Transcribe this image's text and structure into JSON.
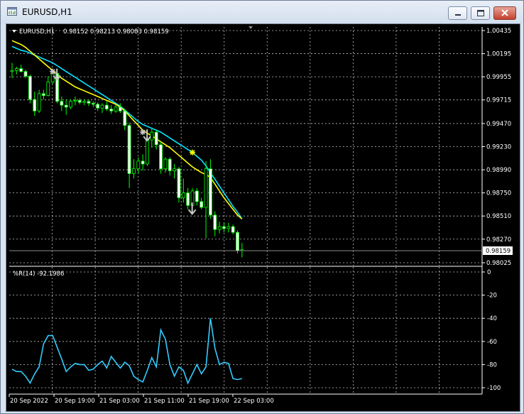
{
  "window": {
    "title": "EURUSD,H1",
    "buttons": [
      "minimize",
      "maximize",
      "close"
    ]
  },
  "chart_header": {
    "symbol_label": "EURUSD,H1",
    "ohlc_text": "0.98152 0.98213 0.98083 0.98159"
  },
  "indicator_header": {
    "label": "%R(14) -92.1986"
  },
  "price_axis_labels": [
    "1.00435",
    "1.00195",
    "0.99955",
    "0.99715",
    "0.99470",
    "0.99230",
    "0.98990",
    "0.98750",
    "0.98510",
    "0.98270",
    "0.98025"
  ],
  "current_price_label": "0.98159",
  "indicator_axis_labels": [
    "0",
    "-20",
    "-40",
    "-60",
    "-80",
    "-100"
  ],
  "time_axis_labels": [
    "20 Sep 2022",
    "20 Sep 19:00",
    "21 Sep 03:00",
    "21 Sep 11:00",
    "21 Sep 19:00",
    "22 Sep 03:00"
  ],
  "colors": {
    "background": "#000000",
    "grid": "#ffffff",
    "candle": "#00ff00",
    "candle_bull_body": "#000000",
    "candle_bear_body": "#ffffff",
    "ma_slow": "#ffff00",
    "ma_fast": "#00e5ff",
    "wpr_line": "#33ccff",
    "arrow": "#c8c8c8",
    "axis_text": "#ffffff"
  },
  "chart_data": [
    {
      "type": "candlestick",
      "title": "EURUSD,H1",
      "ylim": [
        0.98025,
        1.00435
      ],
      "ohlc": [
        [
          1.0001,
          1.001,
          0.9994,
          1.0002
        ],
        [
          1.0002,
          1.0006,
          0.9998,
          1.0004
        ],
        [
          1.0004,
          1.0008,
          1.0,
          1.0001
        ],
        [
          1.0001,
          1.0003,
          0.9994,
          0.9996
        ],
        [
          0.9996,
          0.9998,
          0.9968,
          0.9972
        ],
        [
          0.9972,
          0.998,
          0.9955,
          0.996
        ],
        [
          0.996,
          0.9982,
          0.9958,
          0.9978
        ],
        [
          0.9978,
          0.9982,
          0.9972,
          0.9976
        ],
        [
          0.9976,
          0.9996,
          0.9975,
          0.999
        ],
        [
          0.999,
          1.0001,
          0.9988,
          0.9999
        ],
        [
          0.9999,
          1.0001,
          0.9968,
          0.997
        ],
        [
          0.997,
          0.9975,
          0.996,
          0.9966
        ],
        [
          0.9966,
          0.9972,
          0.9956,
          0.9964
        ],
        [
          0.9964,
          0.9972,
          0.9962,
          0.997
        ],
        [
          0.997,
          0.9975,
          0.9966,
          0.9971
        ],
        [
          0.9971,
          0.9973,
          0.9967,
          0.9969
        ],
        [
          0.9969,
          0.9972,
          0.9966,
          0.997
        ],
        [
          0.997,
          0.9972,
          0.9965,
          0.9968
        ],
        [
          0.9968,
          0.997,
          0.9964,
          0.9967
        ],
        [
          0.9967,
          0.9969,
          0.996,
          0.9963
        ],
        [
          0.9963,
          0.9968,
          0.9958,
          0.9966
        ],
        [
          0.9966,
          0.997,
          0.996,
          0.9962
        ],
        [
          0.9962,
          0.9966,
          0.9957,
          0.996
        ],
        [
          0.996,
          0.9967,
          0.9958,
          0.9964
        ],
        [
          0.9964,
          0.9968,
          0.9958,
          0.996
        ],
        [
          0.996,
          0.9962,
          0.994,
          0.9945
        ],
        [
          0.9945,
          0.9948,
          0.988,
          0.9895
        ],
        [
          0.9895,
          0.991,
          0.989,
          0.99
        ],
        [
          0.99,
          0.9912,
          0.9895,
          0.9908
        ],
        [
          0.9908,
          0.9915,
          0.9898,
          0.9905
        ],
        [
          0.9905,
          0.9935,
          0.9903,
          0.993
        ],
        [
          0.993,
          0.9942,
          0.9922,
          0.9938
        ],
        [
          0.9938,
          0.994,
          0.992,
          0.9925
        ],
        [
          0.9925,
          0.9928,
          0.9895,
          0.99
        ],
        [
          0.99,
          0.9912,
          0.9896,
          0.991
        ],
        [
          0.991,
          0.9912,
          0.9893,
          0.9898
        ],
        [
          0.9898,
          0.9905,
          0.989,
          0.99
        ],
        [
          0.99,
          0.9902,
          0.9865,
          0.987
        ],
        [
          0.987,
          0.989,
          0.9865,
          0.9875
        ],
        [
          0.9875,
          0.988,
          0.9858,
          0.9862
        ],
        [
          0.9862,
          0.988,
          0.9858,
          0.9877
        ],
        [
          0.9877,
          0.988,
          0.9862,
          0.9866
        ],
        [
          0.9866,
          0.987,
          0.9858,
          0.986
        ],
        [
          0.986,
          0.9908,
          0.9828,
          0.99
        ],
        [
          0.99,
          0.991,
          0.9848,
          0.9852
        ],
        [
          0.9852,
          0.9856,
          0.983,
          0.9837
        ],
        [
          0.9837,
          0.9845,
          0.9833,
          0.984
        ],
        [
          0.984,
          0.9844,
          0.9834,
          0.9838
        ],
        [
          0.9838,
          0.9844,
          0.9834,
          0.984
        ],
        [
          0.984,
          0.9842,
          0.9832,
          0.9834
        ],
        [
          0.9834,
          0.9836,
          0.9812,
          0.9815
        ],
        [
          0.9815,
          0.9823,
          0.9808,
          0.9816
        ]
      ],
      "series": [
        {
          "values": [
            1.0027,
            1.0025,
            1.0023,
            1.0022,
            1.002,
            1.0018,
            1.0016,
            1.0014,
            1.0012,
            1.001,
            1.0007,
            1.0004,
            1.0001,
            0.9998,
            0.9995,
            0.9992,
            0.9989,
            0.9986,
            0.9983,
            0.998,
            0.9977,
            0.9974,
            0.9971,
            0.9968,
            0.9965,
            0.9961,
            0.9957,
            0.9953,
            0.9949,
            0.9946,
            0.9944,
            0.9942,
            0.994,
            0.9938,
            0.9935,
            0.9932,
            0.9929,
            0.9926,
            0.9923,
            0.992,
            0.9917,
            0.9913,
            0.9909,
            0.9903,
            0.9896,
            0.9889,
            0.9882,
            0.9875,
            0.9868,
            0.9861,
            0.9855,
            0.9848
          ]
        },
        {
          "values": [
            1.0033,
            1.0031,
            1.0029,
            1.0026,
            1.0022,
            1.0018,
            1.0014,
            1.001,
            1.0006,
            1.0002,
            0.9998,
            0.9994,
            0.9991,
            0.9988,
            0.9985,
            0.9983,
            0.9981,
            0.9979,
            0.9977,
            0.9975,
            0.9973,
            0.9971,
            0.9969,
            0.9967,
            0.9964,
            0.996,
            0.9955,
            0.995,
            0.9945,
            0.994,
            0.9937,
            0.9934,
            0.9931,
            0.9928,
            0.9925,
            0.9922,
            0.9918,
            0.9914,
            0.991,
            0.9906,
            0.9902,
            0.9899,
            0.9896,
            0.9894,
            0.9891,
            0.9884,
            0.9877,
            0.987,
            0.9864,
            0.9858,
            0.9852,
            0.9848
          ]
        }
      ],
      "arrows": [
        {
          "bar": 9,
          "price": 1.0001,
          "dir": "down"
        },
        {
          "bar": 29,
          "price": 0.9938,
          "dir": "down"
        },
        {
          "bar": 39,
          "price": 0.9862,
          "dir": "down"
        }
      ],
      "signal_stars": [
        {
          "bar": 9,
          "price": 1.0001,
          "color": "#c8c8c8"
        },
        {
          "bar": 29,
          "price": 0.9938,
          "color": "#c8c8c8"
        },
        {
          "bar": 40,
          "price": 0.9917,
          "color": "#ffff00"
        }
      ]
    },
    {
      "type": "line",
      "title": "%R(14) -92.1986",
      "ylim": [
        -100,
        0
      ],
      "values": [
        -84,
        -86,
        -86,
        -90,
        -96,
        -88,
        -82,
        -62,
        -55,
        -55,
        -65,
        -75,
        -86,
        -82,
        -79,
        -80,
        -80,
        -85,
        -84,
        -80,
        -77,
        -83,
        -73,
        -78,
        -83,
        -78,
        -81,
        -90,
        -93,
        -95,
        -85,
        -74,
        -82,
        -50,
        -58,
        -80,
        -90,
        -82,
        -85,
        -96,
        -88,
        -80,
        -88,
        -82,
        -40,
        -66,
        -80,
        -78,
        -79,
        -92,
        -93,
        -92
      ]
    }
  ]
}
